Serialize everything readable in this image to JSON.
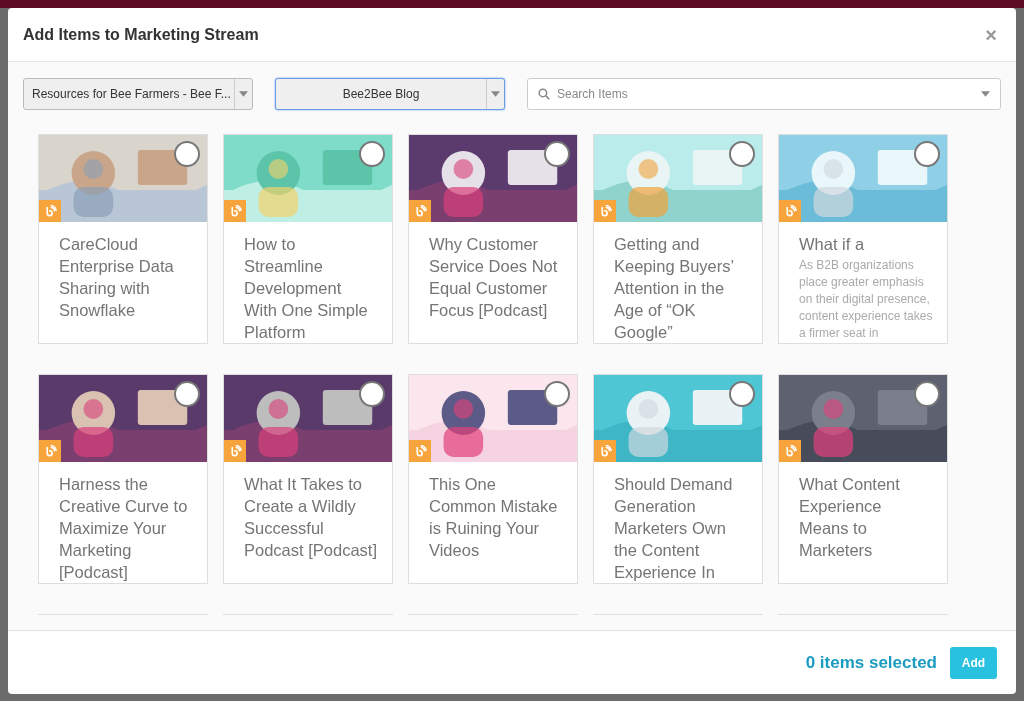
{
  "dialog": {
    "title": "Add Items to Marketing Stream",
    "close": "×"
  },
  "filters": {
    "hub": {
      "value": "Resources for Bee Farmers - Bee F..."
    },
    "stream": {
      "value": "Bee2Bee Blog",
      "focused": true
    },
    "search": {
      "placeholder": "Search Items"
    }
  },
  "cards": [
    {
      "title": "CareCloud Enterprise Data Sharing with Snowflake",
      "selected": false
    },
    {
      "title": "How to Streamline Development With One Simple Platform",
      "selected": false
    },
    {
      "title": "Why Customer Service Does Not Equal Customer Focus [Podcast]",
      "selected": false
    },
    {
      "title": "Getting and Keeping Buyers’ Attention in the Age of “OK Google”",
      "selected": false
    },
    {
      "title": "What if a",
      "description": "As B2B organizations place greater emphasis on their digital presence, content experience takes a firmer seat in",
      "selected": false
    },
    {
      "title": "Harness the Creative Curve to Maximize Your Marketing [Podcast]",
      "selected": false
    },
    {
      "title": "What It Takes to Create a Wildly Successful Podcast [Podcast]",
      "selected": false
    },
    {
      "title": "This One Common Mistake is Ruining Your Videos",
      "selected": false
    },
    {
      "title": "Should Demand Generation Marketers Own the Content Experience In",
      "selected": false
    },
    {
      "title": "What Content Experience Means to Marketers",
      "selected": false
    }
  ],
  "footer": {
    "selection_count": "0 items selected",
    "add_button": "Add"
  }
}
